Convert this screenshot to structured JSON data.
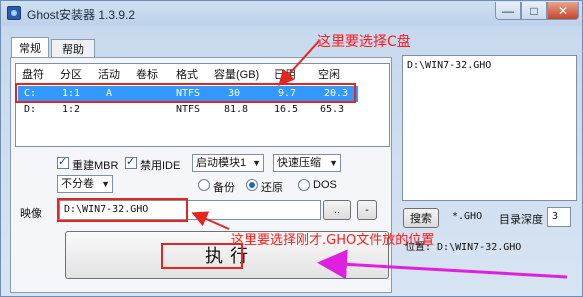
{
  "window": {
    "title": "Ghost安装器 1.3.9.2",
    "minimize_glyph": "—",
    "maximize_glyph": "□",
    "close_glyph": "✕"
  },
  "tabs": [
    {
      "label": "常规",
      "active": true
    },
    {
      "label": "帮助",
      "active": false
    }
  ],
  "partition_table": {
    "headers": [
      "盘符",
      "分区",
      "活动",
      "卷标",
      "格式",
      "容量(GB)",
      "已用",
      "空闲"
    ],
    "rows": [
      {
        "drive": "C:",
        "partition": "1:1",
        "active": "A",
        "label": "",
        "format": "NTFS",
        "capacity": "30",
        "used": "9.7",
        "free": "20.3",
        "selected": true
      },
      {
        "drive": "D:",
        "partition": "1:2",
        "active": "",
        "label": "",
        "format": "NTFS",
        "capacity": "81.8",
        "used": "16.5",
        "free": "65.3",
        "selected": false
      }
    ]
  },
  "options": {
    "rebuild_mbr_label": "重建MBR",
    "rebuild_mbr_checked": true,
    "disable_ide_label": "禁用IDE",
    "disable_ide_checked": true,
    "boot_module": "启动模块1",
    "compression": "快速压缩",
    "split_volume": "不分卷",
    "mode_backup": "备份",
    "mode_restore": "还原",
    "mode_dos": "DOS",
    "selected_mode": "还原"
  },
  "image": {
    "label": "映像",
    "path": "D:\\WIN7-32.GHO",
    "browse_label": "..",
    "minus_label": "-"
  },
  "execute_label": "执    行",
  "right_panel": {
    "found_path": "D:\\WIN7-32.GHO",
    "search_button": "搜索",
    "pattern": "*.GHO",
    "depth_label": "目录深度",
    "depth_value": "3",
    "location_text": "位置: D:\\WIN7-32.GHO"
  },
  "annotations": {
    "select_c": "这里要选择C盘",
    "select_gho": "这里要选择刚才.GHO文件放的位置",
    "color": "#e3261f",
    "arrow_color": "#e020e0"
  }
}
